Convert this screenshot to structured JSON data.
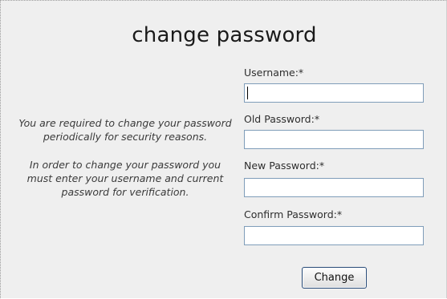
{
  "title": "change password",
  "info": {
    "paragraph1": "You are required to change your password periodically for security reasons.",
    "paragraph2": "In order to change your password you must enter your username and current password for verification."
  },
  "form": {
    "username": {
      "label": "Username:*",
      "value": ""
    },
    "old_password": {
      "label": "Old Password:*",
      "value": ""
    },
    "new_password": {
      "label": "New Password:*",
      "value": ""
    },
    "confirm_password": {
      "label": "Confirm Password:*",
      "value": ""
    },
    "submit_label": "Change"
  }
}
